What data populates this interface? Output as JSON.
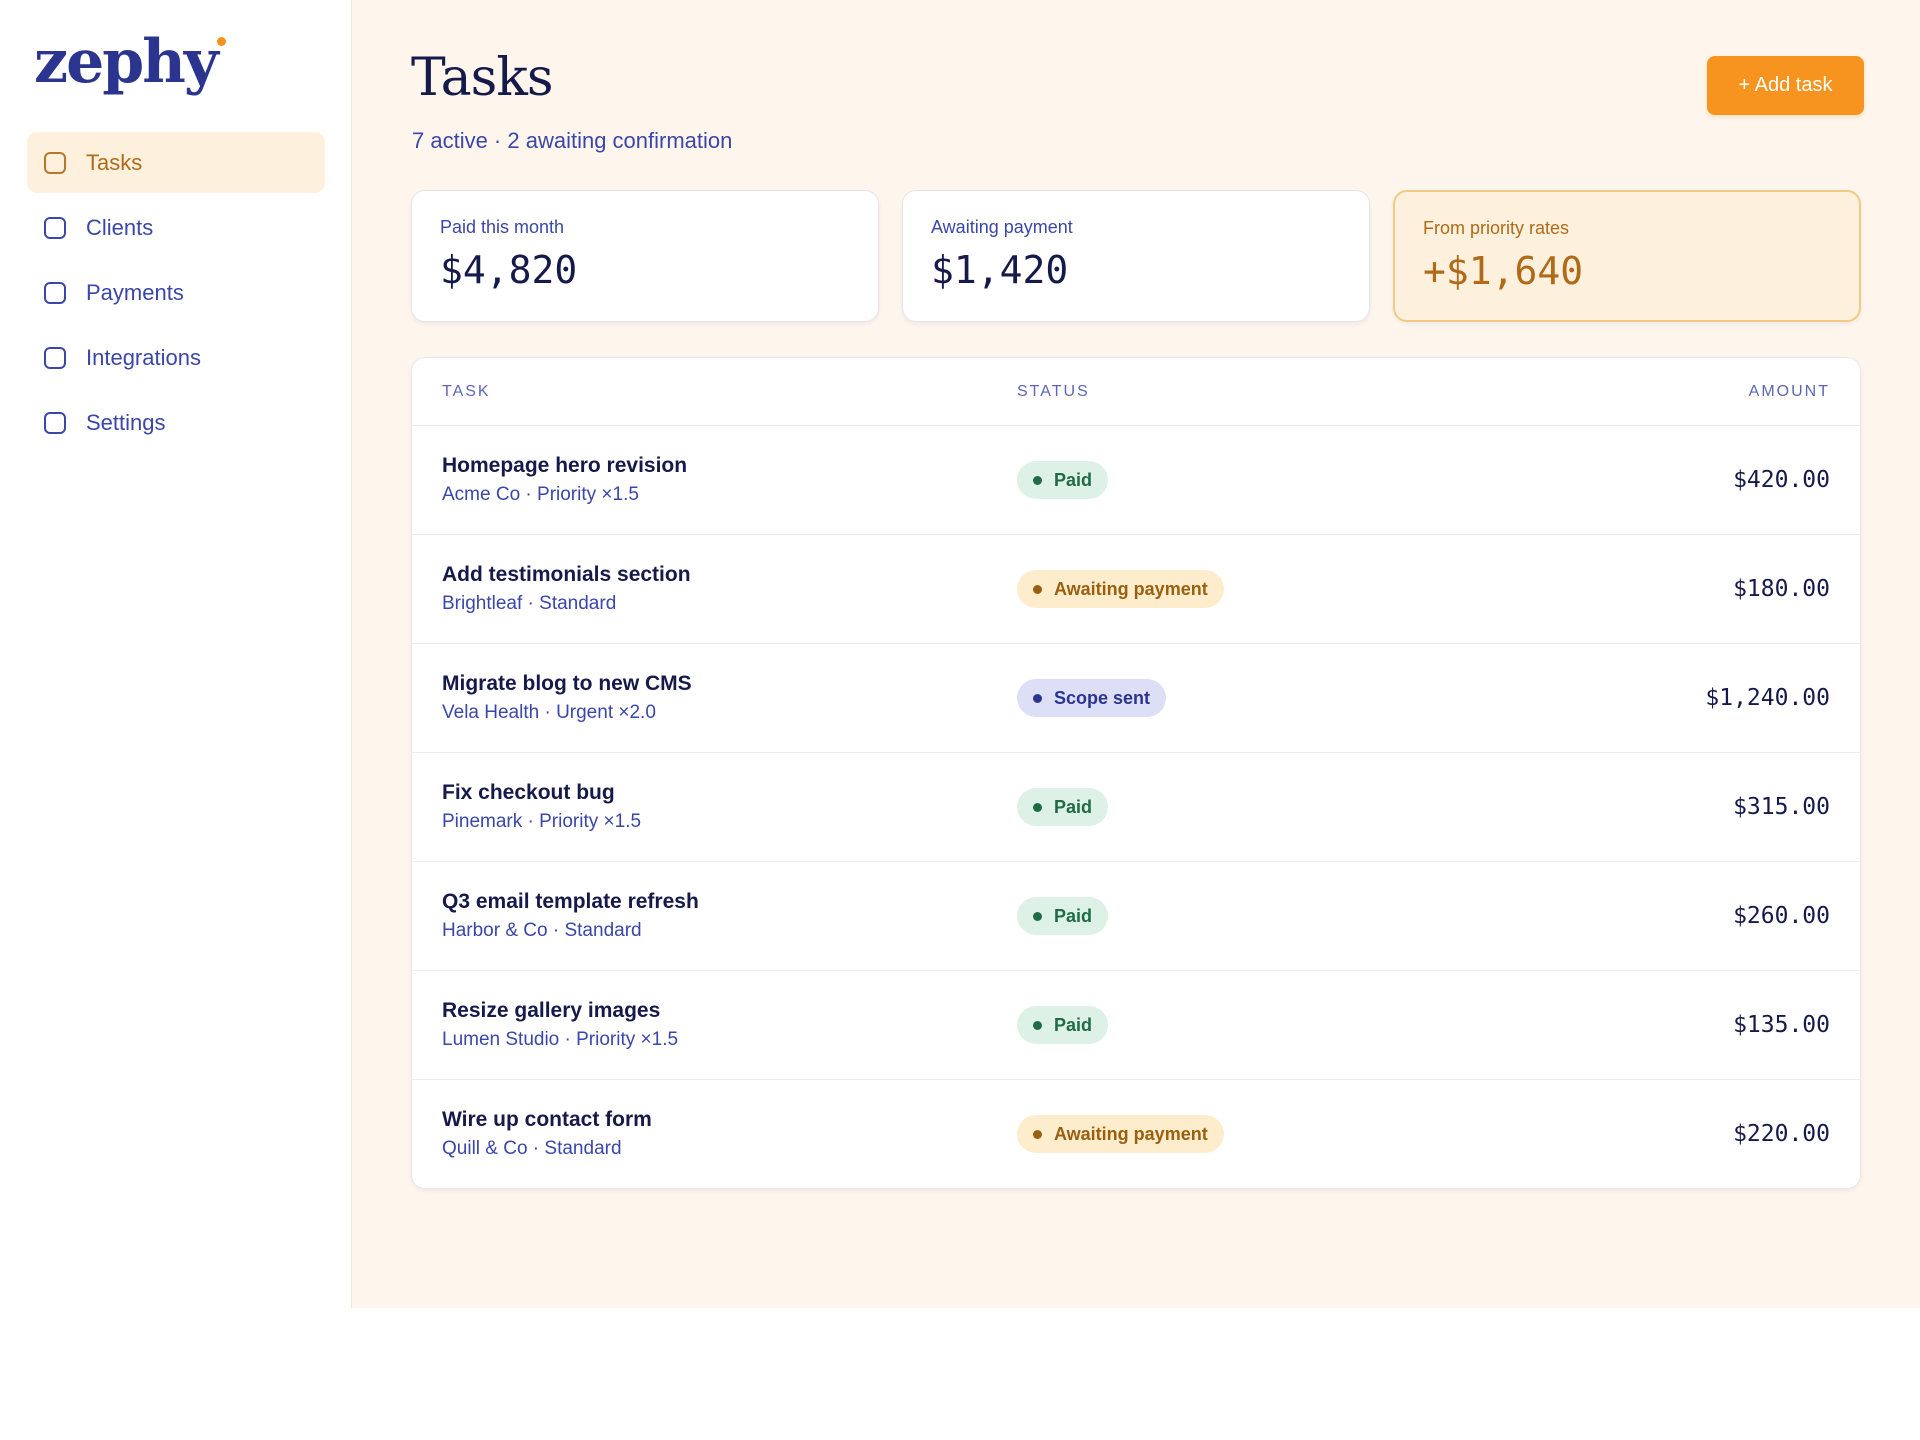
{
  "brand": {
    "name": "zephy",
    "accent": "#f5921e",
    "primary": "#2b358f"
  },
  "sidebar": {
    "items": [
      {
        "label": "Tasks",
        "active": true
      },
      {
        "label": "Clients",
        "active": false
      },
      {
        "label": "Payments",
        "active": false
      },
      {
        "label": "Integrations",
        "active": false
      },
      {
        "label": "Settings",
        "active": false
      }
    ]
  },
  "header": {
    "title": "Tasks",
    "subtitle": "7 active · 2 awaiting confirmation",
    "add_button": "+ Add task"
  },
  "stats": [
    {
      "label": "Paid this month",
      "value": "$4,820"
    },
    {
      "label": "Awaiting payment",
      "value": "$1,420"
    },
    {
      "label": "From priority rates",
      "value": "+$1,640"
    }
  ],
  "table": {
    "columns": {
      "task": "TASK",
      "status": "STATUS",
      "amount": "AMOUNT"
    },
    "rows": [
      {
        "name": "Homepage hero revision",
        "meta": "Acme Co · Priority ×1.5",
        "status": "Paid",
        "status_type": "paid",
        "amount": "$420.00"
      },
      {
        "name": "Add testimonials section",
        "meta": "Brightleaf · Standard",
        "status": "Awaiting payment",
        "status_type": "awaiting",
        "amount": "$180.00"
      },
      {
        "name": "Migrate blog to new CMS",
        "meta": "Vela Health · Urgent ×2.0",
        "status": "Scope sent",
        "status_type": "scope",
        "amount": "$1,240.00"
      },
      {
        "name": "Fix checkout bug",
        "meta": "Pinemark · Priority ×1.5",
        "status": "Paid",
        "status_type": "paid",
        "amount": "$315.00"
      },
      {
        "name": "Q3 email template refresh",
        "meta": "Harbor & Co · Standard",
        "status": "Paid",
        "status_type": "paid",
        "amount": "$260.00"
      },
      {
        "name": "Resize gallery images",
        "meta": "Lumen Studio · Priority ×1.5",
        "status": "Paid",
        "status_type": "paid",
        "amount": "$135.00"
      },
      {
        "name": "Wire up contact form",
        "meta": "Quill & Co · Standard",
        "status": "Awaiting payment",
        "status_type": "awaiting",
        "amount": "$220.00"
      }
    ]
  }
}
